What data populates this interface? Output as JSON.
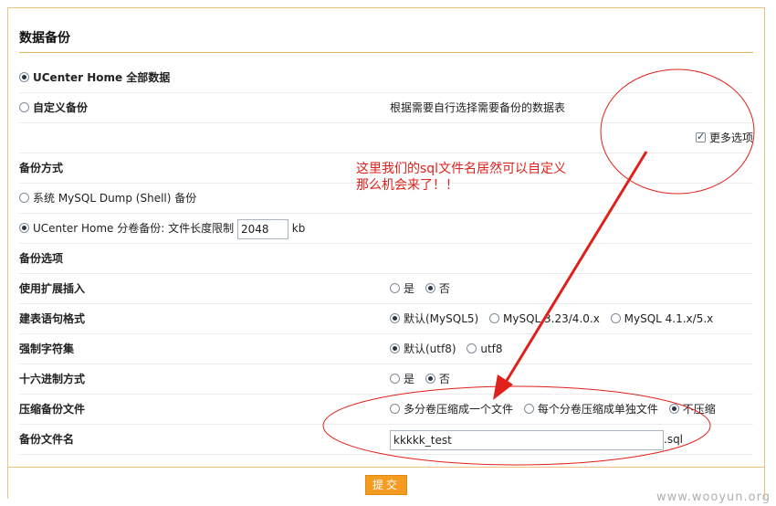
{
  "section": {
    "title": "数据备份"
  },
  "scope": {
    "all_label": "UCenter Home 全部数据",
    "custom_label": "自定义备份",
    "custom_desc": "根据需要自行选择需要备份的数据表",
    "more_options_label": "更多选项",
    "more_options_checked": true
  },
  "method": {
    "heading": "备份方式",
    "shell_label": "系统 MySQL Dump (Shell) 备份",
    "ucenter_label": "UCenter Home 分卷备份: 文件长度限制",
    "size_limit_value": "2048",
    "size_unit": "kb"
  },
  "options": {
    "heading": "备份选项",
    "extended_insert": {
      "label": "使用扩展插入",
      "yes": "是",
      "no": "否"
    },
    "create_format": {
      "label": "建表语句格式",
      "default": "默认(MySQL5)",
      "mysql323": "MySQL 3.23/4.0.x",
      "mysql41": "MySQL 4.1.x/5.x"
    },
    "charset": {
      "label": "强制字符集",
      "default": "默认(utf8)",
      "utf8": "utf8"
    },
    "hex": {
      "label": "十六进制方式",
      "yes": "是",
      "no": "否"
    },
    "compress": {
      "label": "压缩备份文件",
      "multi_one": "多分卷压缩成一个文件",
      "each": "每个分卷压缩成单独文件",
      "none": "不压缩"
    },
    "filename": {
      "label": "备份文件名",
      "value": "kkkkk_test",
      "ext": ".sql"
    }
  },
  "submit": {
    "label": "提交"
  },
  "annotation": {
    "line1": "这里我们的sql文件名居然可以自定义",
    "line2": "那么机会来了！！",
    "color": "#e0201a"
  },
  "watermark": "www.wooyun.org"
}
